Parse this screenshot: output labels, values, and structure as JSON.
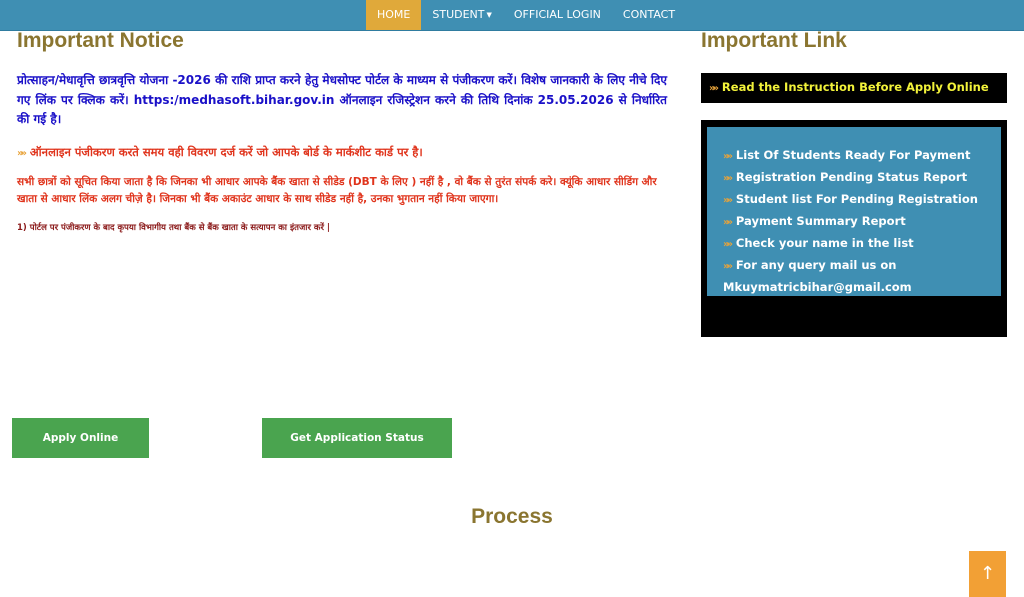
{
  "nav": {
    "items": [
      {
        "label": "HOME"
      },
      {
        "label": "STUDENT"
      },
      {
        "label": "OFFICIAL LOGIN"
      },
      {
        "label": "CONTACT"
      }
    ]
  },
  "notice": {
    "heading": "Important Notice",
    "para1": "प्रोत्साहन/मेधावृत्ति छात्रवृत्ति योजना -2026 की राशि प्राप्त करने हेतु मेधसोफ्ट पोर्टल के माध्यम से पंजीकरण करें। विशेष जानकारी के लिए नीचे दिए गए लिंक पर क्लिक करें। https:/medhasoft.bihar.gov.in ऑनलाइन रजिस्ट्रेशन करने की तिथि दिनांक 25.05.2026 से निर्धारित की गई है।",
    "line2": "ऑनलाइन पंजीकरण करते समय वही विवरण दर्ज करें जो आपके बोर्ड के मार्कशीट कार्ड पर है।",
    "para3": "सभी छात्रों को सूचित किया जाता है कि जिनका भी आधार आपके बैंक खाता से सीडेड (DBT के लिए ) नहीं है , वो बैंक से तुरंत संपर्क करे। क्यूंकि आधार सीडिंग और खाता से आधार लिंक अलग चीज़े है। जिनका भी बैंक अकाउंट आधार के साथ सीडेड नहीं है, उनका भुगतान नहीं किया जाएगा।",
    "line4": "1) पोर्टल पर पंजीकरण के बाद कृपया विभागीय तथा बैंक से बैंक खाता के सत्यापन का इंतजार करें |"
  },
  "links": {
    "heading": "Important Link",
    "instruction": "Read the Instruction Before Apply Online",
    "items": [
      {
        "label": "List Of Students Ready For Payment"
      },
      {
        "label": "Registration Pending Status Report"
      },
      {
        "label": "Student list For Pending Registration"
      },
      {
        "label": "Payment Summary Report"
      },
      {
        "label": "Check your name in the list"
      },
      {
        "label": "For any query mail us on Mkuymatricbihar@gmail.com"
      }
    ]
  },
  "buttons": {
    "apply": "Apply Online",
    "status": "Get Application Status"
  },
  "process": {
    "heading": "Process"
  },
  "back_to_top": "↑",
  "colors": {
    "nav": "#3f8fb3",
    "active": "#e0a93a",
    "heading": "#8a7530",
    "button": "#4aa44f",
    "back_to_top": "#f2a035"
  }
}
